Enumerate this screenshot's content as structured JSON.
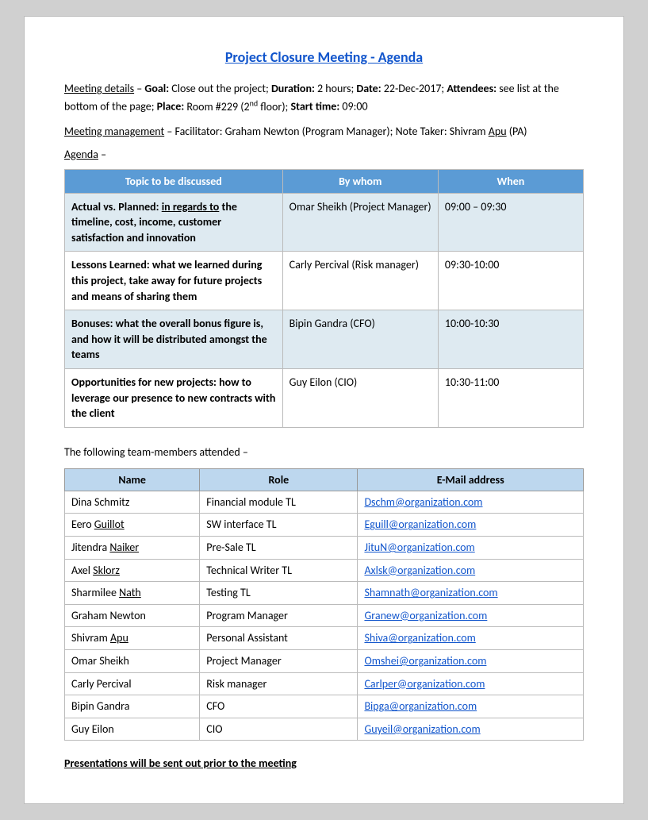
{
  "title": "Project Closure Meeting - Agenda",
  "meeting_details": {
    "label": "Meeting details",
    "goal_label": "Goal:",
    "goal_value": "Close out the project;",
    "duration_label": "Duration:",
    "duration_value": "2 hours;",
    "date_label": "Date:",
    "date_value": "22-Dec-2017;",
    "attendees_label": "Attendees:",
    "attendees_value": "see list at the bottom of the page;",
    "place_label": "Place:",
    "place_value": "Room #229 (2",
    "place_suffix": "nd",
    "place_end": "floor);",
    "start_label": "Start time:",
    "start_value": "09:00"
  },
  "meeting_management": {
    "label": "Meeting management",
    "text": "– Facilitator: Graham Newton (Program Manager); Note Taker: Shivram Apu (PA)"
  },
  "agenda_label": "Agenda",
  "agenda_dash": "–",
  "agenda_table": {
    "headers": [
      "Topic to be discussed",
      "By whom",
      "When"
    ],
    "rows": [
      {
        "topic": "Actual vs. Planned: in regards to the timeline, cost, income, customer satisfaction and innovation",
        "by_whom": "Omar Sheikh (Project Manager)",
        "when": "09:00 – 09:30",
        "highlight": true,
        "topic_has_underline": true
      },
      {
        "topic": "Lessons Learned: what we learned during this project, take away for future projects and means of sharing them",
        "by_whom": "Carly Percival (Risk manager)",
        "when": "09:30-10:00",
        "highlight": false,
        "topic_has_underline": false
      },
      {
        "topic": "Bonuses: what the overall bonus figure is, and how it will be distributed amongst the teams",
        "by_whom": "Bipin Gandra (CFO)",
        "when": "10:00-10:30",
        "highlight": true,
        "topic_has_underline": false
      },
      {
        "topic": "Opportunities for new projects: how to leverage our presence to new contracts with the client",
        "by_whom": "Guy Eilon (CIO)",
        "when": "10:30-11:00",
        "highlight": false,
        "topic_has_underline": false
      }
    ]
  },
  "attendees_intro": "The following team-members attended –",
  "attendees_table": {
    "headers": [
      "Name",
      "Role",
      "E-Mail address"
    ],
    "rows": [
      {
        "name": "Dina Schmitz",
        "role": "Financial module TL",
        "email": "Dschm@organization.com"
      },
      {
        "name": "Eero Guillot",
        "role": "SW interface TL",
        "email": "Eguill@organization.com"
      },
      {
        "name": "Jitendra Naiker",
        "role": "Pre-Sale TL",
        "email": "JituN@organization.com"
      },
      {
        "name": "Axel Sklorz",
        "role": "Technical Writer TL",
        "email": "Axlsk@organization.com"
      },
      {
        "name": "Sharmilee Nath",
        "role": "Testing TL",
        "email": "Shamnath@organization.com"
      },
      {
        "name": "Graham Newton",
        "role": "Program Manager",
        "email": "Granew@organization.com"
      },
      {
        "name": "Shivram Apu",
        "role": "Personal Assistant",
        "email": "Shiva@organization.com"
      },
      {
        "name": "Omar Sheikh",
        "role": "Project Manager",
        "email": "Omshei@organization.com"
      },
      {
        "name": "Carly Percival",
        "role": "Risk manager",
        "email": "Carlper@organization.com"
      },
      {
        "name": "Bipin Gandra",
        "role": "CFO",
        "email": "Bipga@organization.com"
      },
      {
        "name": "Guy Eilon",
        "role": "CIO",
        "email": "Guyeil@organization.com"
      }
    ]
  },
  "footer_note": "Presentations will be sent out prior to the meeting"
}
